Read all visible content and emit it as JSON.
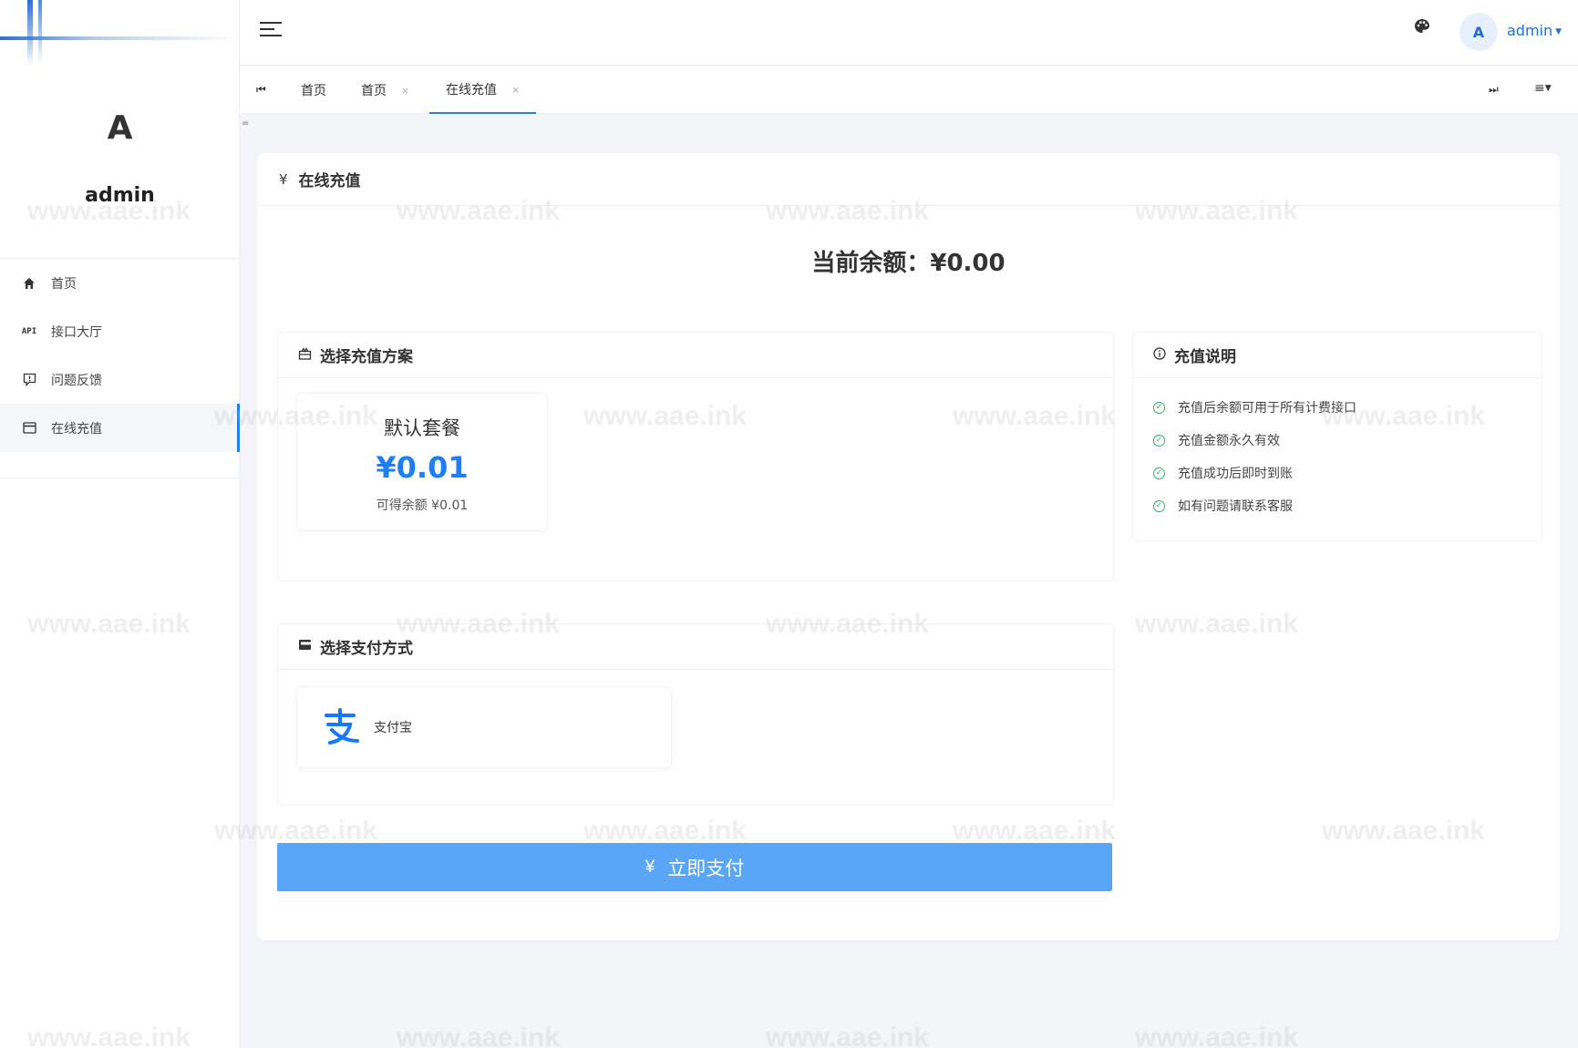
{
  "sidebar": {
    "avatar_letter": "A",
    "username": "admin",
    "items": [
      {
        "label": "首页",
        "icon": "home-icon"
      },
      {
        "label": "接口大厅",
        "icon": "api-icon",
        "icon_text": "API"
      },
      {
        "label": "问题反馈",
        "icon": "feedback-icon"
      },
      {
        "label": "在线充值",
        "icon": "wallet-icon"
      }
    ]
  },
  "header": {
    "avatar_letter": "A",
    "username": "admin"
  },
  "tabs": {
    "items": [
      {
        "label": "首页",
        "closable": false
      },
      {
        "label": "首页",
        "closable": true
      },
      {
        "label": "在线充值",
        "closable": true,
        "active": true
      }
    ],
    "close_glyph": "×"
  },
  "main": {
    "title": "在线充值",
    "title_icon": "¥",
    "balance_text": "当前余额：¥0.00",
    "plan_section": {
      "title": "选择充值方案",
      "plans": [
        {
          "name": "默认套餐",
          "price": "¥0.01",
          "get": "可得余额 ¥0.01"
        }
      ]
    },
    "info_section": {
      "title": "充值说明",
      "items": [
        "充值后余额可用于所有计费接口",
        "充值金额永久有效",
        "充值成功后即时到账",
        "如有问题请联系客服"
      ]
    },
    "pay_section": {
      "title": "选择支付方式",
      "methods": [
        {
          "name": "支付宝",
          "icon": "alipay-icon"
        }
      ]
    },
    "pay_button": {
      "icon": "¥",
      "label": "立即支付"
    }
  },
  "watermark": "www.aae.ink",
  "colors": {
    "accent": "#1e7ef5",
    "pay_button": "#5aa6f6",
    "check": "#2fb36b"
  }
}
